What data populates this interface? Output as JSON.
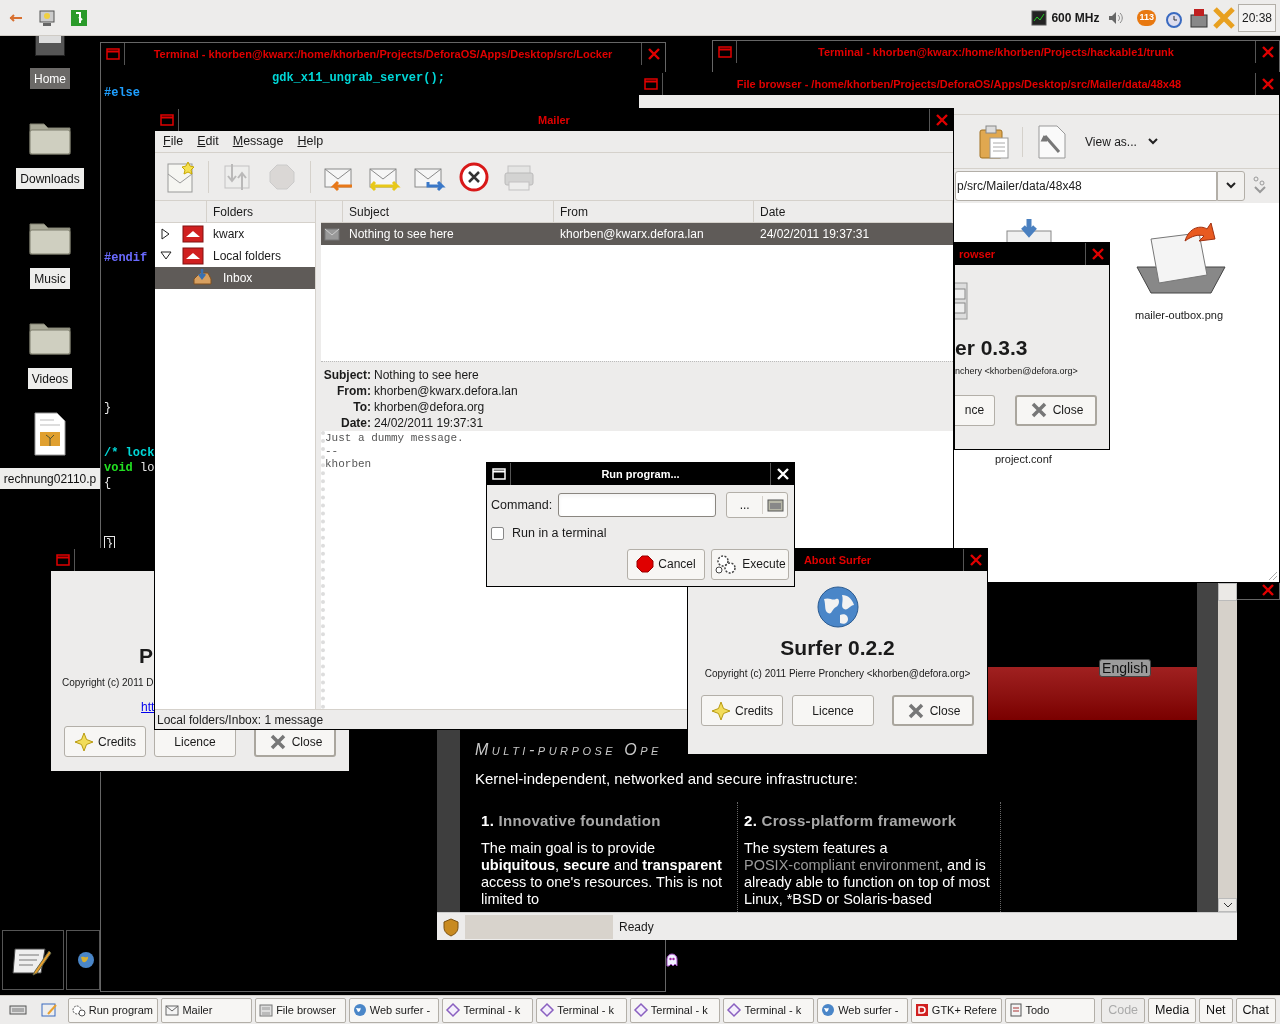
{
  "top_panel": {
    "cpu_speed": "600 MHz",
    "tray_badge": "113",
    "clock": "20:38"
  },
  "desktop_icons": [
    {
      "label": "Home",
      "kind": "drive",
      "selected": true
    },
    {
      "label": "Downloads",
      "kind": "folder",
      "selected": false
    },
    {
      "label": "Music",
      "kind": "folder",
      "selected": false
    },
    {
      "label": "Videos",
      "kind": "folder",
      "selected": false
    },
    {
      "label": "rechnung02110.p",
      "kind": "document",
      "selected": false
    }
  ],
  "terminal_locker": {
    "title": "Terminal - khorben@kwarx:/home/khorben/Projects/DeforaOS/Apps/Desktop/src/Locker",
    "active": false,
    "lines": [
      {
        "segments": [
          {
            "text": "gdk_x11_ungrab_server();",
            "color": "#00d7d7",
            "bold": true
          }
        ]
      },
      {
        "segments": [
          {
            "text": "#else",
            "color": "#1e9fff",
            "bold": true
          }
        ]
      },
      {
        "segments": [
          {
            "text": "#endif",
            "color": "#6a6aff",
            "bold": true
          }
        ]
      },
      {
        "segments": [
          {
            "text": "}",
            "color": "#e8e8e8",
            "bold": false
          }
        ]
      },
      {
        "segments": [
          {
            "text": "/* lock",
            "color": "#00d7d7",
            "bold": true
          }
        ]
      },
      {
        "segments": [
          {
            "text": "void",
            "color": "#22e022",
            "bold": true
          },
          {
            "text": " lo",
            "color": "#e8e8e8",
            "bold": false
          }
        ]
      },
      {
        "segments": [
          {
            "text": "{",
            "color": "#e8e8e8",
            "bold": false
          }
        ]
      },
      {
        "segments": [
          {
            "text": "}",
            "color": "#e8e8e8",
            "bold": false
          }
        ],
        "cursor": true
      }
    ]
  },
  "terminal_hackable": {
    "title": "Terminal - khorben@kwarx:/home/khorben/Projects/hackable1/trunk",
    "active": false
  },
  "file_browser": {
    "title": "File browser - /home/khorben/Projects/DeforaOS/Apps/Desktop/src/Mailer/data/48x48",
    "active": false,
    "view_as": "View as...",
    "path": "p/src/Mailer/data/48x48",
    "files": [
      {
        "name": "mailer-outbox.png",
        "kind": "outbox"
      },
      {
        "name": "project.conf",
        "kind": "text"
      }
    ]
  },
  "file_browser_about": {
    "title": "rowser",
    "active": false,
    "name": "er 0.3.3",
    "copyright": "nchery <khorben@defora.org>",
    "buttons": [
      {
        "label": "nce",
        "kind": "licence"
      },
      {
        "label": "Close",
        "kind": "close"
      }
    ]
  },
  "about_left": {
    "name": "P",
    "copyright": "Copyright (c) 2011 D",
    "link": "htt",
    "buttons": [
      {
        "label": "Credits",
        "kind": "credits"
      },
      {
        "label": "Licence",
        "kind": "licence"
      },
      {
        "label": "Close",
        "kind": "close"
      }
    ]
  },
  "web_surfer": {
    "language": "English",
    "heading": "Multi-purpose Ope",
    "progress": {
      "level": 0
    },
    "intro": "Kernel-independent, networked and secure infrastructure:",
    "sections": [
      {
        "number": "1.",
        "title": "Innovative foundation",
        "text": "The main goal is to provide **ubiquitous**, **secure** and **transparent** access to one's resources. This is not limited to"
      },
      {
        "number": "2.",
        "title": "Cross-platform framework",
        "text_before": "The system features a ",
        "link": "POSIX-compliant environment",
        "text_after": ", and is already able to function on top of most Linux, *BSD or Solaris-based"
      }
    ],
    "status": "Ready"
  },
  "mailer": {
    "title": "Mailer",
    "active": false,
    "menu": [
      "File",
      "Edit",
      "Message",
      "Help"
    ],
    "toolbar": [
      {
        "kind": "new",
        "disabled": false
      },
      {
        "kind": "send_receive",
        "disabled": true
      },
      {
        "kind": "stop",
        "disabled": true
      },
      {
        "kind": "reply",
        "disabled": false
      },
      {
        "kind": "reply_all",
        "disabled": false
      },
      {
        "kind": "forward",
        "disabled": false
      },
      {
        "kind": "delete",
        "disabled": false
      },
      {
        "kind": "print",
        "disabled": true
      }
    ],
    "folders_header": "Folders",
    "folders": [
      {
        "label": "kwarx",
        "expanded": false,
        "selected": false
      },
      {
        "label": "Local folders",
        "expanded": true,
        "selected": false,
        "children": [
          {
            "label": "Inbox",
            "selected": true
          }
        ]
      }
    ],
    "columns": [
      "Subject",
      "From",
      "Date"
    ],
    "messages": [
      {
        "subject": "Nothing to see here",
        "from": "khorben@kwarx.defora.lan",
        "date": "24/02/2011 19:37:31",
        "selected": true
      }
    ],
    "headers": [
      {
        "label": "Subject:",
        "value": "Nothing to see here"
      },
      {
        "label": "From:",
        "value": "khorben@kwarx.defora.lan"
      },
      {
        "label": "To:",
        "value": "khorben@defora.org"
      },
      {
        "label": "Date:",
        "value": "24/02/2011 19:37:31"
      }
    ],
    "body": [
      "Just a dummy message.",
      "--",
      "khorben"
    ],
    "status": "Local folders/Inbox: 1 message"
  },
  "about_surfer": {
    "title": "About Surfer",
    "active": false,
    "name": "Surfer 0.2.2",
    "copyright": "Copyright (c) 2011 Pierre Pronchery <khorben@defora.org>",
    "buttons": [
      {
        "label": "Credits",
        "kind": "credits"
      },
      {
        "label": "Licence",
        "kind": "licence"
      },
      {
        "label": "Close",
        "kind": "close"
      }
    ]
  },
  "run_program": {
    "title": "Run program...",
    "active": true,
    "command_label": "Command:",
    "browse": "...",
    "run_in_terminal": {
      "label": "Run in a terminal",
      "checked": false
    },
    "buttons": [
      {
        "label": "Cancel",
        "kind": "cancel"
      },
      {
        "label": "Execute",
        "kind": "execute"
      }
    ]
  },
  "taskbar": {
    "tasks": [
      {
        "label": "Run program",
        "kind": "run"
      },
      {
        "label": "Mailer",
        "kind": "mail"
      },
      {
        "label": "File browser",
        "kind": "folder"
      },
      {
        "label": "Web surfer -",
        "kind": "web"
      },
      {
        "label": "Terminal - k",
        "kind": "terminal"
      },
      {
        "label": "Terminal - k",
        "kind": "terminal"
      },
      {
        "label": "Terminal - k",
        "kind": "terminal"
      },
      {
        "label": "Terminal - k",
        "kind": "terminal"
      },
      {
        "label": "Web surfer -",
        "kind": "web"
      },
      {
        "label": "GTK+ Refere",
        "kind": "doc"
      },
      {
        "label": "Todo",
        "kind": "todo"
      }
    ],
    "buttons": [
      {
        "label": "Code",
        "disabled": true
      },
      {
        "label": "Media",
        "disabled": false
      },
      {
        "label": "Net",
        "disabled": false
      },
      {
        "label": "Chat",
        "disabled": false
      }
    ]
  }
}
